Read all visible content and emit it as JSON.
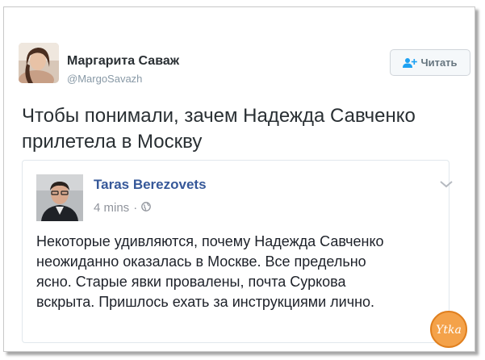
{
  "tweet": {
    "author_name": "Маргарита Саваж",
    "author_handle": "@MargoSavazh",
    "follow_label": "Читать",
    "text": "Чтобы понимали, зачем Надежда Савченко\nприлетела в Москву"
  },
  "quoted_post": {
    "author_name": "Taras Berezovets",
    "time": "4 mins",
    "separator": "·",
    "text": "Некоторые удивляются, почему Надежда Савченко\nнеожиданно оказалась в Москве. Все предельно\nясно. Старые явки провалены, почта Суркова\nвскрыта. Пришлось ехать за инструкциями лично."
  },
  "watermark": {
    "text": "Ytka"
  },
  "colors": {
    "name": "#292f33",
    "handle": "#8899a6",
    "fb_link": "#365899",
    "fb_meta": "#90949c",
    "follow_icon": "#1da1f2"
  },
  "icons": {
    "follow": "add-user-icon",
    "privacy": "globe-icon",
    "menu": "chevron-down-icon"
  }
}
